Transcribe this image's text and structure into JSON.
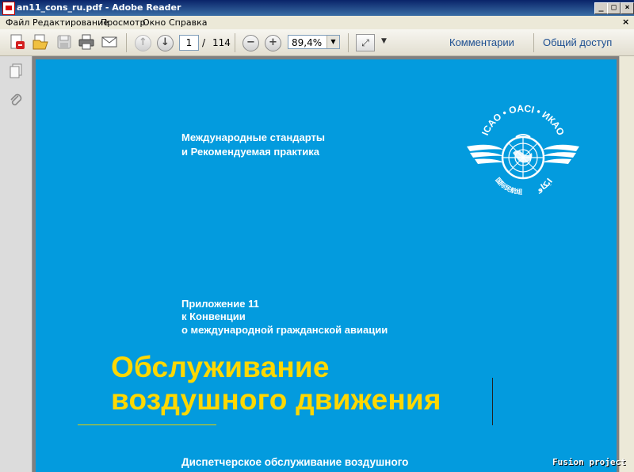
{
  "window": {
    "title": "an11_cons_ru.pdf - Adobe Reader"
  },
  "menu": {
    "items": [
      "Файл",
      "Редактирование",
      "Просмотр",
      "Окно",
      "Справка"
    ]
  },
  "toolbar": {
    "page_current": "1",
    "page_separator": "/",
    "page_total": "114",
    "zoom_value": "89,4%",
    "link_comments": "Комментарии",
    "link_share": "Общий доступ"
  },
  "document": {
    "standards_line1": "Международные стандарты",
    "standards_line2": "и Рекомендуемая практика",
    "annex_line1": "Приложение 11",
    "annex_line2": "к Конвенции",
    "annex_line3": "о международной гражданской авиации",
    "title_line1": "Обслуживание",
    "title_line2": "воздушного движения",
    "subtitle": "Диспетчерское обслуживание воздушного",
    "emblem_top_text": "ICAO • OACI • ИКАО",
    "emblem_chinese_text": "国际民航组织",
    "emblem_arabic_text": "ايكاو",
    "page_color": "#039bde",
    "title_color": "#ffd800"
  },
  "watermark": "Fusion project"
}
